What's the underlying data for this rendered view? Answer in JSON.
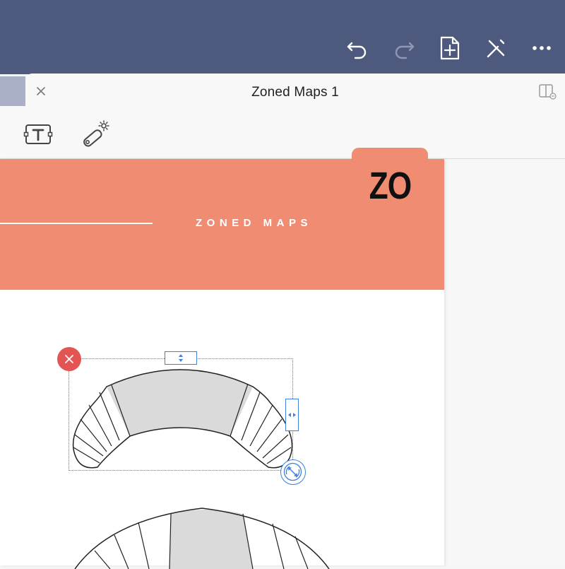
{
  "app": {
    "toolbar_icons": [
      "undo-icon",
      "redo-icon",
      "add-page-icon",
      "pen-tools-icon",
      "more-icon"
    ],
    "accent_color": "#4e5a7d"
  },
  "document": {
    "title": "Zoned Maps 1",
    "close_icon": "close-icon",
    "split_view_icon": "split-view-icon"
  },
  "tools": {
    "items": [
      "text-tool-icon",
      "laser-pointer-icon"
    ]
  },
  "page": {
    "banner_title": "ZONED MAPS",
    "banner_color": "#ef8c72",
    "badge_text": "ZO"
  },
  "selection": {
    "delete_icon": "delete-icon",
    "handle_color": "#3d7fe0"
  }
}
